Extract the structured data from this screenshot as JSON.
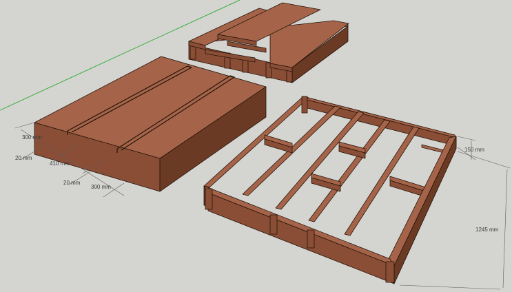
{
  "dimensions": {
    "d300_top": "300 mm",
    "d20_a": "20 mm",
    "d410": "410 mm",
    "d20_b": "20 mm",
    "d300_bottom": "300 mm",
    "d150": "150 mm",
    "d1245": "1245 mm"
  },
  "colors": {
    "background": "#d4d4d1",
    "wood_top": "#a5644a",
    "wood_front": "#8a4e36",
    "wood_side": "#6b3a24",
    "axis_green": "#3cae3c",
    "outline": "#241408"
  }
}
